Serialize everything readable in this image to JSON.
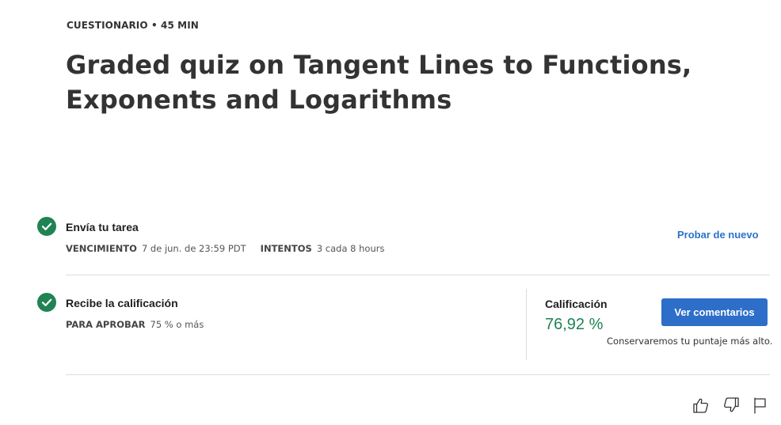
{
  "header": {
    "eyebrow": "CUESTIONARIO • 45 MIN",
    "title": "Graded quiz on Tangent Lines to Functions, Exponents and Logarithms"
  },
  "submit_step": {
    "icon": "check-circle-icon",
    "title": "Envía tu tarea",
    "due_label": "VENCIMIENTO",
    "due_value": "7 de jun. de 23:59 PDT",
    "attempts_label": "INTENTOS",
    "attempts_value": "3 cada 8 hours",
    "retry_label": "Probar de nuevo"
  },
  "grade_step": {
    "icon": "check-circle-icon",
    "title": "Recibe la calificación",
    "pass_label": "PARA APROBAR",
    "pass_value": "75 % o más",
    "grade_label": "Calificación",
    "grade_value": "76,92 %",
    "feedback_button": "Ver comentarios",
    "note": "Conservaremos tu puntaje más alto."
  },
  "feedback_icons": [
    "thumbs-up-icon",
    "thumbs-down-icon",
    "flag-icon"
  ],
  "colors": {
    "success": "#1f8354",
    "link": "#2a73cc",
    "button": "#2d6ec8"
  }
}
